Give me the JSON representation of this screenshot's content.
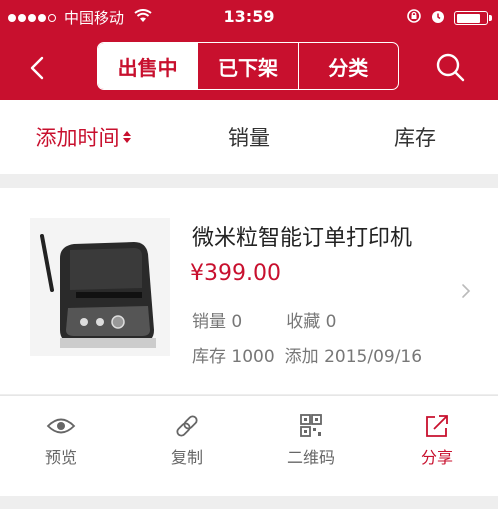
{
  "status_bar": {
    "carrier": "中国移动",
    "time": "13:59",
    "battery_level": 0.8
  },
  "nav": {
    "tabs": [
      {
        "label": "出售中",
        "active": true
      },
      {
        "label": "已下架",
        "active": false
      },
      {
        "label": "分类",
        "active": false
      }
    ]
  },
  "sort": {
    "items": [
      {
        "label": "添加时间",
        "active": true
      },
      {
        "label": "销量",
        "active": false
      },
      {
        "label": "库存",
        "active": false
      }
    ]
  },
  "product": {
    "name": "微米粒智能订单打印机",
    "price": "¥399.00",
    "sales_label": "销量 0",
    "favorites_label": "收藏 0",
    "stock_label": "库存 1000",
    "added_label": "添加 2015/09/16"
  },
  "actions": [
    {
      "label": "预览",
      "icon": "eye-icon"
    },
    {
      "label": "复制",
      "icon": "link-icon"
    },
    {
      "label": "二维码",
      "icon": "qrcode-icon"
    },
    {
      "label": "分享",
      "icon": "share-icon"
    }
  ],
  "colors": {
    "brand": "#c8102e",
    "background": "#eeeeee"
  }
}
